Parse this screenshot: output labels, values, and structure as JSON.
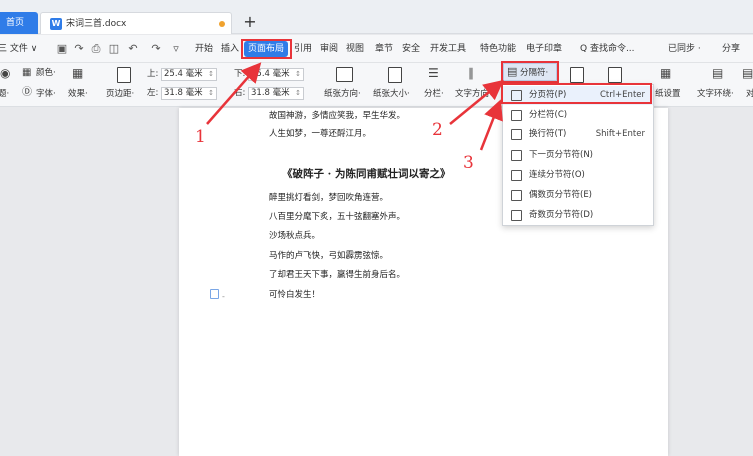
{
  "tabs": {
    "home": "首页",
    "doc_icon": "W",
    "doc_name": "宋词三首.docx",
    "add": "+"
  },
  "menubar": {
    "file": "三 文件 ∨",
    "items": [
      "开始",
      "插入",
      "页面布局",
      "引用",
      "审阅",
      "视图",
      "章节",
      "安全",
      "开发工具",
      "特色功能",
      "电子印章"
    ],
    "search": "Q 查找命令...",
    "sync": "已同步 ·",
    "share": "分享"
  },
  "ribbon": {
    "theme": "题·",
    "color": "颜色·",
    "font": "字体·",
    "effect": "效果·",
    "margin": "页边距·",
    "top_label": "上:",
    "top_value": "25.4 毫米",
    "bottom_label": "下:",
    "bottom_value": "25.4 毫米",
    "left_label": "左:",
    "left_value": "31.8 毫米",
    "right_label": "右:",
    "right_value": "31.8 毫米",
    "orientation": "纸张方向·",
    "size": "纸张大小·",
    "columns": "分栏·",
    "text_direction": "文字方向·",
    "separator": "分隔符·",
    "paper_settings": "纸设置",
    "wrap": "文字环绕·",
    "align": "对"
  },
  "document": {
    "lines_top": [
      "故国神游，多情应笑我，早生华发。",
      "人生如梦，一尊还酹江月。"
    ],
    "poem_title": "《破阵子 · 为陈同甫赋壮词以寄之》",
    "poem_lines": [
      "醉里挑灯看剑，梦回吹角连营。",
      "八百里分麾下炙，五十弦翻塞外声。",
      "沙场秋点兵。",
      "马作的卢飞快，弓如霹雳弦惊。",
      "了却君王天下事，赢得生前身后名。",
      "可怜白发生！"
    ]
  },
  "dropdown": {
    "items": [
      {
        "label": "分页符(P)",
        "shortcut": "Ctrl+Enter"
      },
      {
        "label": "分栏符(C)",
        "shortcut": ""
      },
      {
        "label": "换行符(T)",
        "shortcut": "Shift+Enter"
      },
      {
        "label": "下一页分节符(N)",
        "shortcut": ""
      },
      {
        "label": "连续分节符(O)",
        "shortcut": ""
      },
      {
        "label": "偶数页分节符(E)",
        "shortcut": ""
      },
      {
        "label": "奇数页分节符(D)",
        "shortcut": ""
      }
    ]
  },
  "annotations": {
    "step1": "1",
    "step2": "2",
    "step3": "3",
    "color": "#e8343a"
  },
  "colors": {
    "accent": "#2f7ce8",
    "annotation": "#e8343a"
  }
}
